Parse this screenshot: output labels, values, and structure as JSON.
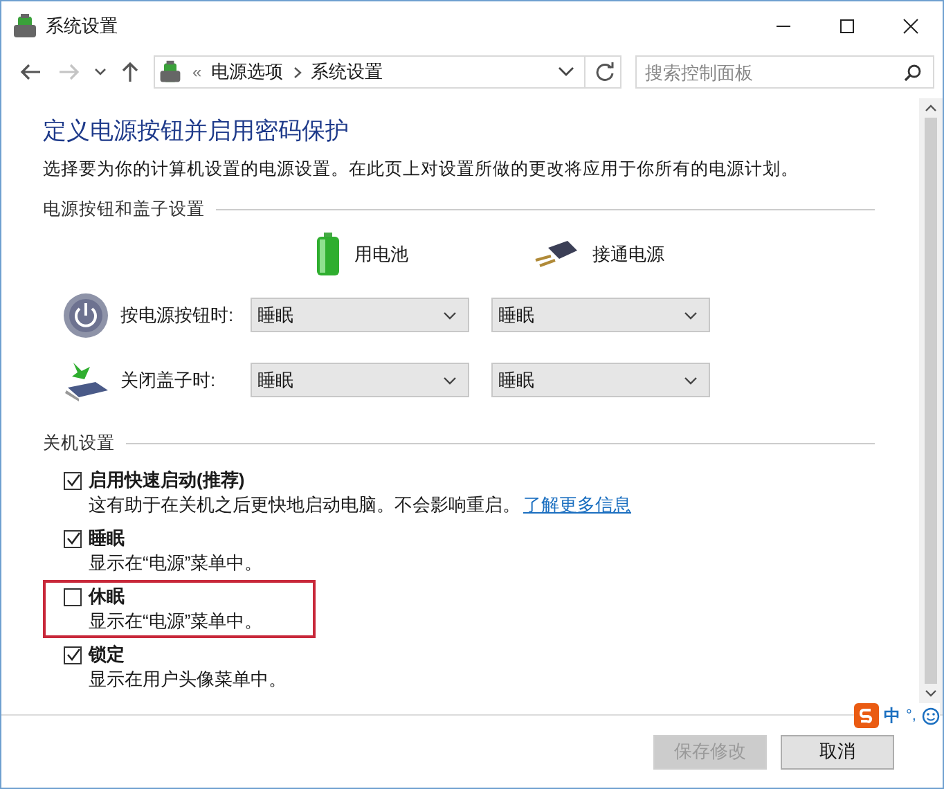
{
  "window": {
    "title": "系统设置"
  },
  "nav": {
    "buttons": [
      {
        "kind": "back",
        "disabled": false
      },
      {
        "kind": "forward",
        "disabled": true
      },
      {
        "kind": "recent",
        "disabled": false
      },
      {
        "kind": "up",
        "disabled": false
      }
    ],
    "address": {
      "overflow": "«",
      "crumbs": [
        "电源选项",
        "系统设置"
      ]
    },
    "search": {
      "placeholder": "搜索控制面板"
    }
  },
  "heading": "定义电源按钮并启用密码保护",
  "description": "选择要为你的计算机设置的电源设置。在此页上对设置所做的更改将应用于你所有的电源计划。",
  "power_section": {
    "title": "电源按钮和盖子设置",
    "columns": [
      {
        "kind": "battery",
        "label": "用电池"
      },
      {
        "kind": "plug",
        "label": "接通电源"
      }
    ],
    "rows": [
      {
        "kind": "power",
        "label": "按电源按钮时:",
        "values": [
          "睡眠",
          "睡眠"
        ]
      },
      {
        "kind": "lid",
        "label": "关闭盖子时:",
        "values": [
          "睡眠",
          "睡眠"
        ]
      }
    ]
  },
  "shutdown_section": {
    "title": "关机设置",
    "options": [
      {
        "label": "启用快速启动(推荐)",
        "checked": true,
        "highlighted": false,
        "description": "这有助于在关机之后更快地启动电脑。不会影响重启。",
        "link": "了解更多信息"
      },
      {
        "label": "睡眠",
        "checked": true,
        "highlighted": false,
        "description": "显示在“电源”菜单中。"
      },
      {
        "label": "休眠",
        "checked": false,
        "highlighted": true,
        "description": "显示在“电源”菜单中。"
      },
      {
        "label": "锁定",
        "checked": true,
        "highlighted": false,
        "description": "显示在用户头像菜单中。"
      }
    ]
  },
  "ime": {
    "mode": "中",
    "punctuation": "°,"
  },
  "buttons": [
    {
      "label": "保存修改",
      "disabled": true
    },
    {
      "label": "取消",
      "disabled": false
    }
  ]
}
